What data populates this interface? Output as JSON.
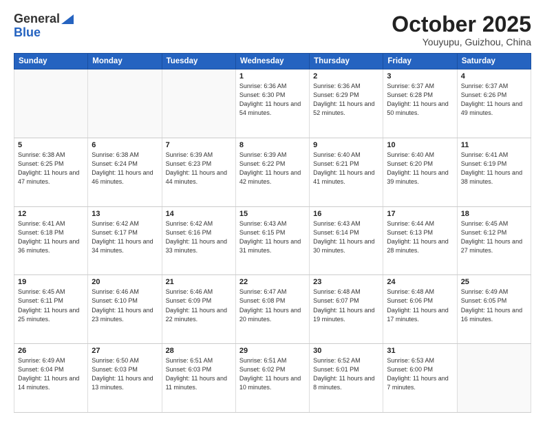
{
  "header": {
    "logo_general": "General",
    "logo_blue": "Blue",
    "month_title": "October 2025",
    "location": "Youyupu, Guizhou, China"
  },
  "days_of_week": [
    "Sunday",
    "Monday",
    "Tuesday",
    "Wednesday",
    "Thursday",
    "Friday",
    "Saturday"
  ],
  "weeks": [
    [
      {
        "day": "",
        "info": ""
      },
      {
        "day": "",
        "info": ""
      },
      {
        "day": "",
        "info": ""
      },
      {
        "day": "1",
        "info": "Sunrise: 6:36 AM\nSunset: 6:30 PM\nDaylight: 11 hours\nand 54 minutes."
      },
      {
        "day": "2",
        "info": "Sunrise: 6:36 AM\nSunset: 6:29 PM\nDaylight: 11 hours\nand 52 minutes."
      },
      {
        "day": "3",
        "info": "Sunrise: 6:37 AM\nSunset: 6:28 PM\nDaylight: 11 hours\nand 50 minutes."
      },
      {
        "day": "4",
        "info": "Sunrise: 6:37 AM\nSunset: 6:26 PM\nDaylight: 11 hours\nand 49 minutes."
      }
    ],
    [
      {
        "day": "5",
        "info": "Sunrise: 6:38 AM\nSunset: 6:25 PM\nDaylight: 11 hours\nand 47 minutes."
      },
      {
        "day": "6",
        "info": "Sunrise: 6:38 AM\nSunset: 6:24 PM\nDaylight: 11 hours\nand 46 minutes."
      },
      {
        "day": "7",
        "info": "Sunrise: 6:39 AM\nSunset: 6:23 PM\nDaylight: 11 hours\nand 44 minutes."
      },
      {
        "day": "8",
        "info": "Sunrise: 6:39 AM\nSunset: 6:22 PM\nDaylight: 11 hours\nand 42 minutes."
      },
      {
        "day": "9",
        "info": "Sunrise: 6:40 AM\nSunset: 6:21 PM\nDaylight: 11 hours\nand 41 minutes."
      },
      {
        "day": "10",
        "info": "Sunrise: 6:40 AM\nSunset: 6:20 PM\nDaylight: 11 hours\nand 39 minutes."
      },
      {
        "day": "11",
        "info": "Sunrise: 6:41 AM\nSunset: 6:19 PM\nDaylight: 11 hours\nand 38 minutes."
      }
    ],
    [
      {
        "day": "12",
        "info": "Sunrise: 6:41 AM\nSunset: 6:18 PM\nDaylight: 11 hours\nand 36 minutes."
      },
      {
        "day": "13",
        "info": "Sunrise: 6:42 AM\nSunset: 6:17 PM\nDaylight: 11 hours\nand 34 minutes."
      },
      {
        "day": "14",
        "info": "Sunrise: 6:42 AM\nSunset: 6:16 PM\nDaylight: 11 hours\nand 33 minutes."
      },
      {
        "day": "15",
        "info": "Sunrise: 6:43 AM\nSunset: 6:15 PM\nDaylight: 11 hours\nand 31 minutes."
      },
      {
        "day": "16",
        "info": "Sunrise: 6:43 AM\nSunset: 6:14 PM\nDaylight: 11 hours\nand 30 minutes."
      },
      {
        "day": "17",
        "info": "Sunrise: 6:44 AM\nSunset: 6:13 PM\nDaylight: 11 hours\nand 28 minutes."
      },
      {
        "day": "18",
        "info": "Sunrise: 6:45 AM\nSunset: 6:12 PM\nDaylight: 11 hours\nand 27 minutes."
      }
    ],
    [
      {
        "day": "19",
        "info": "Sunrise: 6:45 AM\nSunset: 6:11 PM\nDaylight: 11 hours\nand 25 minutes."
      },
      {
        "day": "20",
        "info": "Sunrise: 6:46 AM\nSunset: 6:10 PM\nDaylight: 11 hours\nand 23 minutes."
      },
      {
        "day": "21",
        "info": "Sunrise: 6:46 AM\nSunset: 6:09 PM\nDaylight: 11 hours\nand 22 minutes."
      },
      {
        "day": "22",
        "info": "Sunrise: 6:47 AM\nSunset: 6:08 PM\nDaylight: 11 hours\nand 20 minutes."
      },
      {
        "day": "23",
        "info": "Sunrise: 6:48 AM\nSunset: 6:07 PM\nDaylight: 11 hours\nand 19 minutes."
      },
      {
        "day": "24",
        "info": "Sunrise: 6:48 AM\nSunset: 6:06 PM\nDaylight: 11 hours\nand 17 minutes."
      },
      {
        "day": "25",
        "info": "Sunrise: 6:49 AM\nSunset: 6:05 PM\nDaylight: 11 hours\nand 16 minutes."
      }
    ],
    [
      {
        "day": "26",
        "info": "Sunrise: 6:49 AM\nSunset: 6:04 PM\nDaylight: 11 hours\nand 14 minutes."
      },
      {
        "day": "27",
        "info": "Sunrise: 6:50 AM\nSunset: 6:03 PM\nDaylight: 11 hours\nand 13 minutes."
      },
      {
        "day": "28",
        "info": "Sunrise: 6:51 AM\nSunset: 6:03 PM\nDaylight: 11 hours\nand 11 minutes."
      },
      {
        "day": "29",
        "info": "Sunrise: 6:51 AM\nSunset: 6:02 PM\nDaylight: 11 hours\nand 10 minutes."
      },
      {
        "day": "30",
        "info": "Sunrise: 6:52 AM\nSunset: 6:01 PM\nDaylight: 11 hours\nand 8 minutes."
      },
      {
        "day": "31",
        "info": "Sunrise: 6:53 AM\nSunset: 6:00 PM\nDaylight: 11 hours\nand 7 minutes."
      },
      {
        "day": "",
        "info": ""
      }
    ]
  ]
}
